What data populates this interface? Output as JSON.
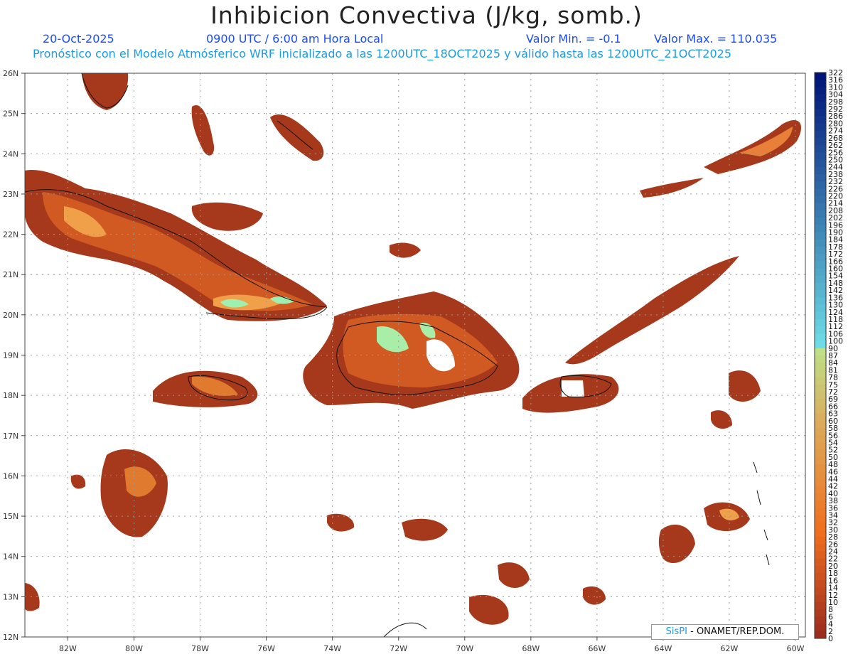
{
  "header": {
    "title": "Inhibicion Convectiva (J/kg, somb.)",
    "date": "20-Oct-2025",
    "time": "0900 UTC / 6:00 am Hora Local",
    "min_label": "Valor Min. = -0.1",
    "max_label": "Valor Max. = 110.035",
    "forecast_line": "Pronóstico con el Modelo Atmósferico WRF inicializado a las 1200UTC_18OCT2025 y válido hasta las  1200UTC_21OCT2025"
  },
  "map": {
    "lat_labels": [
      "26N",
      "25N",
      "24N",
      "23N",
      "22N",
      "21N",
      "20N",
      "19N",
      "18N",
      "17N",
      "16N",
      "15N",
      "14N",
      "13N",
      "12N"
    ],
    "lon_labels": [
      "82W",
      "80W",
      "78W",
      "76W",
      "74W",
      "72W",
      "70W",
      "68W",
      "66W",
      "64W",
      "62W",
      "60W"
    ],
    "lat_range": [
      12,
      26
    ],
    "lon_range": [
      -83.3,
      -59.7
    ],
    "grid": true,
    "field_color": "#a23a1c",
    "field_high_color": "#e8701e",
    "field_peak_color": "#8ff0a8"
  },
  "colorbar": {
    "labels": [
      "322",
      "316",
      "310",
      "304",
      "298",
      "292",
      "286",
      "280",
      "274",
      "268",
      "262",
      "256",
      "250",
      "244",
      "238",
      "232",
      "226",
      "220",
      "214",
      "208",
      "202",
      "196",
      "190",
      "184",
      "178",
      "172",
      "166",
      "160",
      "154",
      "148",
      "142",
      "136",
      "130",
      "124",
      "118",
      "112",
      "106",
      "100",
      "90",
      "87",
      "84",
      "81",
      "78",
      "75",
      "72",
      "69",
      "66",
      "63",
      "60",
      "58",
      "56",
      "54",
      "52",
      "50",
      "48",
      "46",
      "44",
      "42",
      "40",
      "38",
      "36",
      "34",
      "32",
      "30",
      "28",
      "26",
      "24",
      "22",
      "20",
      "18",
      "16",
      "14",
      "12",
      "10",
      "8",
      "6",
      "4",
      "2",
      "0"
    ]
  },
  "credit": {
    "brand": "SisPI",
    "org": " - ONAMET/REP.DOM."
  }
}
